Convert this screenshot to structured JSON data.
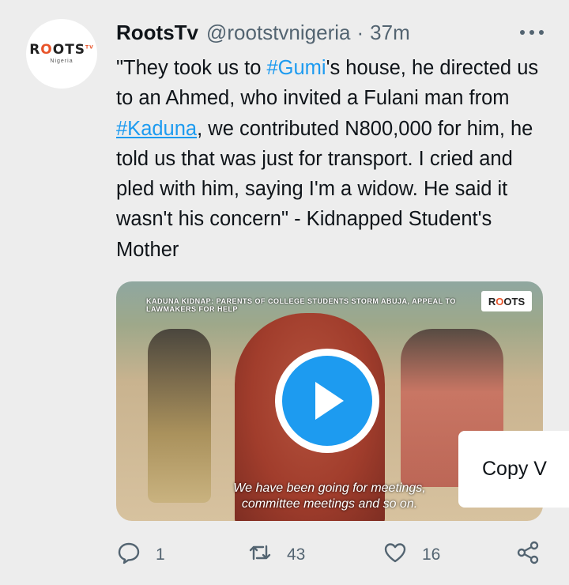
{
  "avatar": {
    "brand_pre": "R",
    "brand_o": "O",
    "brand_post": "OTS",
    "brand_tv": "TV",
    "sub": "Nigeria"
  },
  "header": {
    "name": "RootsTv",
    "handle": "@rootstvnigeria",
    "separator": "·",
    "time": "37m"
  },
  "tweet": {
    "part1": "\"They took us to ",
    "tag1": "#Gumi",
    "part2": "'s house, he directed us to an Ahmed, who invited a Fulani man from ",
    "tag2": "#Kaduna",
    "part3": ", we contributed N800,000 for him, he told us that was just for transport. I cried and pled with him, saying I'm a widow. He said it wasn't his concern\" - Kidnapped Student's Mother"
  },
  "media": {
    "banner": "KADUNA KIDNAP: PARENTS OF COLLEGE STUDENTS STORM ABUJA, APPEAL TO LAWMAKERS FOR HELP",
    "logo_pre": "R",
    "logo_o": "O",
    "logo_post": "OTS",
    "subtitle_line1": "We have been going for meetings,",
    "subtitle_line2": "committee meetings and so on."
  },
  "copy_button": "Copy V",
  "actions": {
    "replies": "1",
    "retweets": "43",
    "likes": "16"
  },
  "colors": {
    "link": "#1d9bf0",
    "muted": "#536471",
    "background": "#ededed",
    "brand_accent": "#e8542a"
  },
  "icons": [
    "more-icon",
    "reply-icon",
    "retweet-icon",
    "like-icon",
    "share-icon",
    "play-icon"
  ]
}
